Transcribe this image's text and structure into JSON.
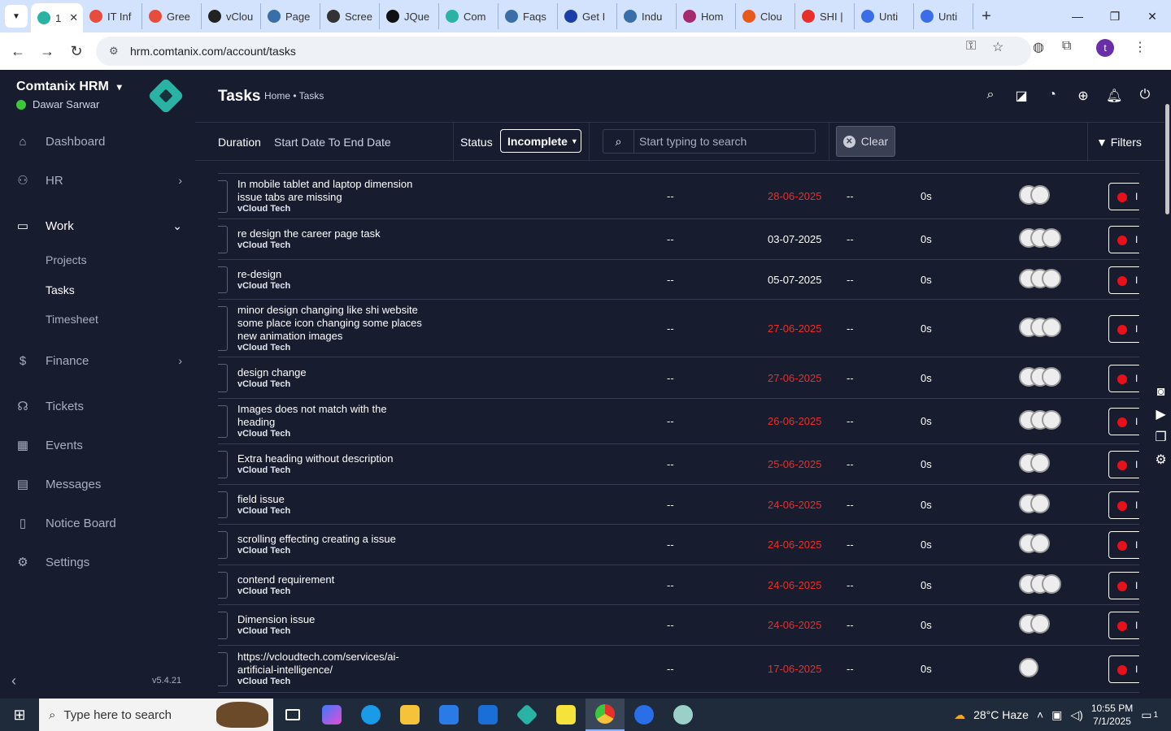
{
  "browser": {
    "tabs": [
      {
        "label": "1",
        "color": "#2ab3a4",
        "active": true
      },
      {
        "label": "IT Inf",
        "color": "#e74c3c"
      },
      {
        "label": "Gree",
        "color": "#e74c3c"
      },
      {
        "label": "vClou",
        "color": "#222222"
      },
      {
        "label": "Page",
        "color": "#3a6ea8"
      },
      {
        "label": "Scree",
        "color": "#333333"
      },
      {
        "label": "JQue",
        "color": "#111111"
      },
      {
        "label": "Com",
        "color": "#2ab3a4"
      },
      {
        "label": "Faqs",
        "color": "#3a6ea8"
      },
      {
        "label": "Get I",
        "color": "#1a3ea8"
      },
      {
        "label": "Indu",
        "color": "#3a6ea8"
      },
      {
        "label": "Hom",
        "color": "#a82a6e"
      },
      {
        "label": "Clou",
        "color": "#e85a1a"
      },
      {
        "label": "SHI |",
        "color": "#e8302a"
      },
      {
        "label": "Unti",
        "color": "#3a6ee8"
      },
      {
        "label": "Unti",
        "color": "#3a6ee8"
      }
    ],
    "url": "hrm.comtanix.com/account/tasks",
    "profile_initial": "t"
  },
  "sidebar": {
    "company": "Comtanix HRM",
    "user": "Dawar Sarwar",
    "items": [
      {
        "label": "Dashboard",
        "icon": "home-icon"
      },
      {
        "label": "HR",
        "icon": "users-icon"
      },
      {
        "label": "Work",
        "icon": "briefcase-icon"
      },
      {
        "label": "Finance",
        "icon": "dollar-icon"
      },
      {
        "label": "Tickets",
        "icon": "headset-icon"
      },
      {
        "label": "Events",
        "icon": "calendar-icon"
      },
      {
        "label": "Messages",
        "icon": "message-icon"
      },
      {
        "label": "Notice Board",
        "icon": "clipboard-icon"
      },
      {
        "label": "Settings",
        "icon": "gear-icon"
      }
    ],
    "work_sub": [
      "Projects",
      "Tasks",
      "Timesheet"
    ],
    "version": "v5.4.21"
  },
  "header": {
    "title": "Tasks",
    "breadcrumb": "Home • Tasks"
  },
  "filters": {
    "duration_label": "Duration",
    "duration_value": "Start Date To End Date",
    "status_label": "Status",
    "status_value": "Incomplete",
    "search_placeholder": "Start typing to search",
    "clear_label": "Clear",
    "filters_label": "Filters"
  },
  "tasks": [
    {
      "name": "In mobile tablet and laptop dimension issue tabs are missing",
      "project": "vCloud Tech",
      "start": "--",
      "due": "28-06-2025",
      "overdue": true,
      "est": "--",
      "hours": "0s",
      "members": 2
    },
    {
      "name": "re design the career page task",
      "project": "vCloud Tech",
      "start": "--",
      "due": "03-07-2025",
      "overdue": false,
      "est": "--",
      "hours": "0s",
      "members": 3
    },
    {
      "name": "re-design",
      "project": "vCloud Tech",
      "start": "--",
      "due": "05-07-2025",
      "overdue": false,
      "est": "--",
      "hours": "0s",
      "members": 3
    },
    {
      "name": "minor design changing like shi website some place icon changing some places new animation images",
      "project": "vCloud Tech",
      "start": "--",
      "due": "27-06-2025",
      "overdue": true,
      "est": "--",
      "hours": "0s",
      "members": 3
    },
    {
      "name": "design change",
      "project": "vCloud Tech",
      "start": "--",
      "due": "27-06-2025",
      "overdue": true,
      "est": "--",
      "hours": "0s",
      "members": 3
    },
    {
      "name": "Images does not match with the heading",
      "project": "vCloud Tech",
      "start": "--",
      "due": "26-06-2025",
      "overdue": true,
      "est": "--",
      "hours": "0s",
      "members": 3
    },
    {
      "name": "Extra heading without description",
      "project": "vCloud Tech",
      "start": "--",
      "due": "25-06-2025",
      "overdue": true,
      "est": "--",
      "hours": "0s",
      "members": 2
    },
    {
      "name": "field issue",
      "project": "vCloud Tech",
      "start": "--",
      "due": "24-06-2025",
      "overdue": true,
      "est": "--",
      "hours": "0s",
      "members": 2
    },
    {
      "name": "scrolling effecting creating a issue",
      "project": "vCloud Tech",
      "start": "--",
      "due": "24-06-2025",
      "overdue": true,
      "est": "--",
      "hours": "0s",
      "members": 2
    },
    {
      "name": "contend requirement",
      "project": "vCloud Tech",
      "start": "--",
      "due": "24-06-2025",
      "overdue": true,
      "est": "--",
      "hours": "0s",
      "members": 3
    },
    {
      "name": "Dimension issue",
      "project": "vCloud Tech",
      "start": "--",
      "due": "24-06-2025",
      "overdue": true,
      "est": "--",
      "hours": "0s",
      "members": 2
    },
    {
      "name": "https://vcloudtech.com/services/ai-artificial-intelligence/",
      "project": "vCloud Tech",
      "start": "--",
      "due": "17-06-2025",
      "overdue": true,
      "est": "--",
      "hours": "0s",
      "members": 1
    }
  ],
  "status_pill_text": "I",
  "taskbar": {
    "search_placeholder": "Type here to search",
    "weather": "28°C  Haze",
    "time": "10:55 PM",
    "date": "7/1/2025",
    "notification_count": "1"
  },
  "colors": {
    "background": "#171c2f",
    "overdue": "#e8302a",
    "brand": "#2ab3a4"
  }
}
